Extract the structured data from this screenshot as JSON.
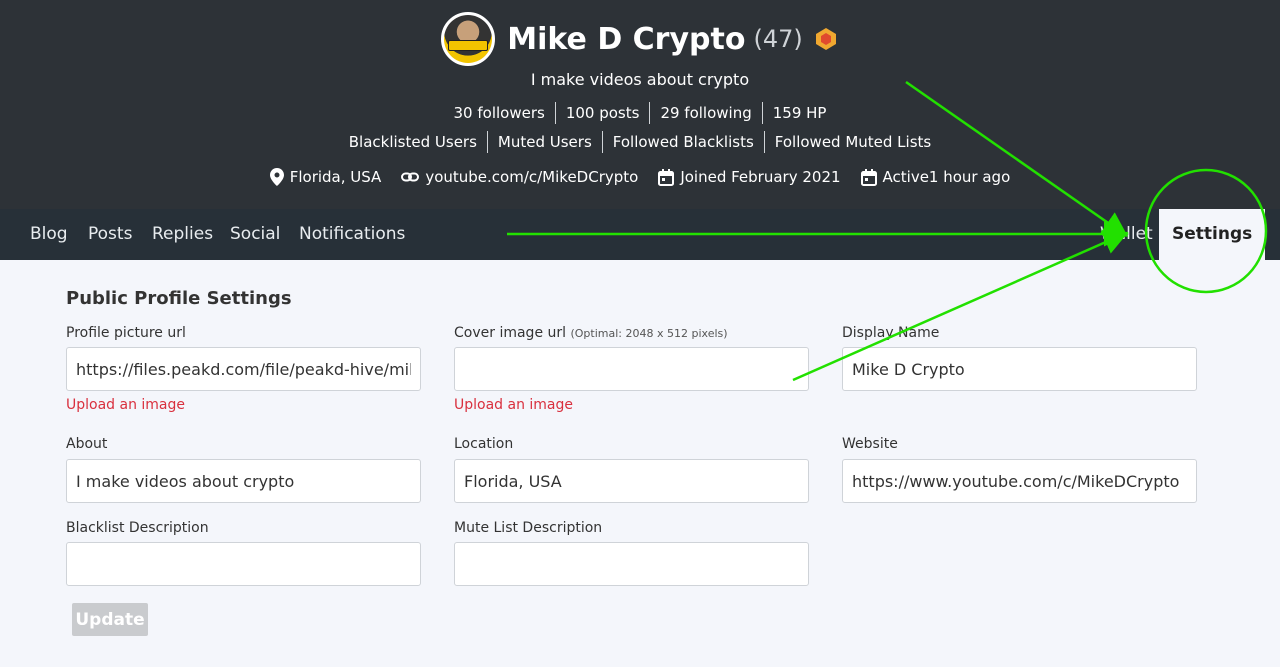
{
  "profile": {
    "name": "Mike D Crypto",
    "reputation": "(47)",
    "bio": "I make videos about crypto",
    "stats": [
      "30 followers",
      "100 posts",
      "29 following",
      "159 HP"
    ],
    "lists": [
      "Blacklisted Users",
      "Muted Users",
      "Followed Blacklists",
      "Followed Muted Lists"
    ],
    "location": "Florida, USA",
    "website": "youtube.com/c/MikeDCrypto",
    "joined": "Joined February 2021",
    "active": "Active1 hour ago"
  },
  "nav": {
    "left": [
      "Blog",
      "Posts",
      "Replies",
      "Social",
      "Notifications"
    ],
    "wallet": "Wallet",
    "settings": "Settings"
  },
  "form": {
    "title": "Public Profile Settings",
    "profile_picture_label": "Profile picture url",
    "profile_picture_value": "https://files.peakd.com/file/peakd-hive/mikedcrypto",
    "cover_label": "Cover image url",
    "cover_hint": "(Optimal: 2048 x 512 pixels)",
    "cover_value": "",
    "display_name_label": "Display Name",
    "display_name_value": "Mike D Crypto",
    "upload_label": "Upload an image",
    "about_label": "About",
    "about_value": "I make videos about crypto",
    "location_label": "Location",
    "location_value": "Florida, USA",
    "website_label": "Website",
    "website_value": "https://www.youtube.com/c/MikeDCrypto",
    "blacklist_label": "Blacklist Description",
    "blacklist_value": "",
    "mutelist_label": "Mute List Description",
    "mutelist_value": "",
    "update_label": "Update"
  },
  "colors": {
    "header_bg": "#2d3237",
    "nav_bg": "#273038",
    "page_bg": "#f4f6fb",
    "upload_link": "#d9303e",
    "annotation": "#22e000"
  },
  "icons": [
    "location-pin-icon",
    "link-icon",
    "calendar-icon",
    "badge-icon"
  ]
}
